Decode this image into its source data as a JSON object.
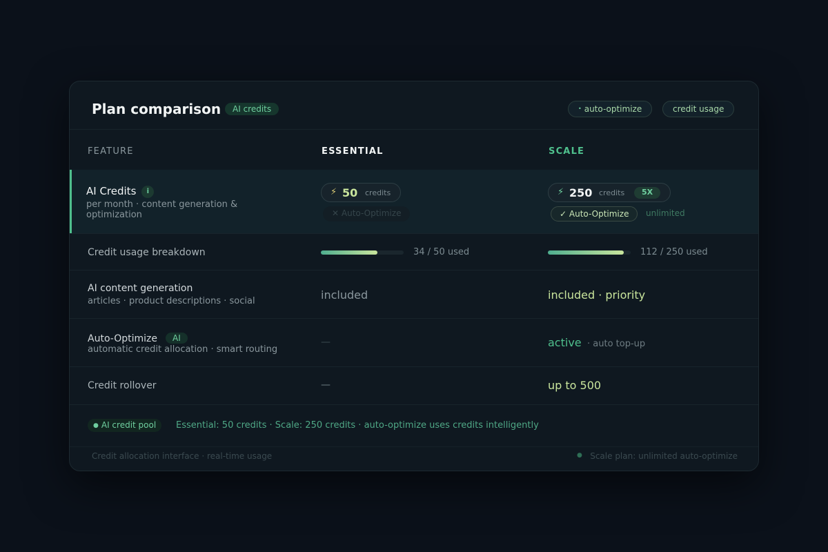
{
  "header": {
    "title": "Plan comparison",
    "badge": "AI credits",
    "dot": "•",
    "buttons": [
      "auto-optimize",
      "credit usage"
    ]
  },
  "columns": {
    "feature": "FEATURE",
    "essential": "ESSENTIAL",
    "scale": "SCALE"
  },
  "rows": {
    "ai_credits": {
      "label": "AI Credits",
      "info_icon": "i",
      "sub": "per month · content generation & optimization",
      "essential": {
        "bolt": "⚡",
        "amount": "50",
        "unit": "credits",
        "auto_optimize_icon": "✕",
        "auto_optimize": "Auto-Optimize"
      },
      "scale": {
        "bolt": "⚡",
        "amount": "250",
        "unit": "credits",
        "multiplier": "5X",
        "auto_optimize_icon": "✓",
        "auto_optimize": "Auto-Optimize",
        "note": "unlimited"
      }
    },
    "usage": {
      "label": "Credit usage breakdown",
      "essential": {
        "used": 34,
        "total": 50,
        "fraction": 0.68,
        "text": "34 / 50 used"
      },
      "scale": {
        "used": 112,
        "total": 250,
        "fraction": 0.92,
        "text": "112 / 250 used"
      }
    },
    "content": {
      "label": "AI content generation",
      "sub": "articles · product descriptions · social",
      "essential": "included",
      "scale": "included · priority"
    },
    "auto_optimize": {
      "label": "Auto-Optimize",
      "tag": "AI",
      "sub": "automatic credit allocation · smart routing",
      "essential": "—",
      "scale": "active",
      "scale_note": "· auto top-up"
    },
    "rollover": {
      "label": "Credit rollover",
      "essential": "—",
      "scale": "up to 500"
    }
  },
  "pool": {
    "tag": "AI credit pool",
    "dot": "●",
    "text": "Essential: 50 credits · Scale: 250 credits · auto-optimize uses credits intelligently"
  },
  "footer": {
    "left": "Credit allocation interface · real-time usage",
    "dot": "●",
    "right": "Scale plan: unlimited auto-optimize"
  },
  "colors": {
    "accent": "#4fc08d",
    "background": "#0b111a",
    "card": "#0f1820"
  }
}
